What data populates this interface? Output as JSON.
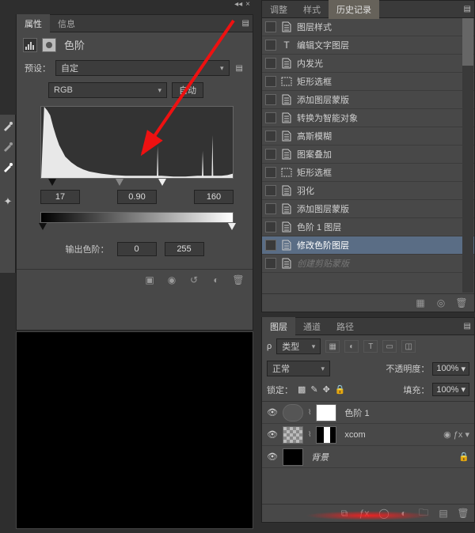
{
  "left": {
    "properties_tab": "属性",
    "info_tab": "信息",
    "panel_title": "色阶",
    "preset_label": "预设：",
    "preset_value": "自定",
    "channel_value": "RGB",
    "auto_btn": "自动",
    "input_levels": {
      "black": "17",
      "gamma": "0.90",
      "white": "160"
    },
    "output_label": "输出色阶：",
    "output_levels": {
      "black": "0",
      "white": "255"
    }
  },
  "right": {
    "adjust_tab": "调整",
    "styles_tab": "样式",
    "history_tab": "历史记录",
    "history": [
      {
        "icon": "doc",
        "label": "图层样式"
      },
      {
        "icon": "T",
        "label": "编辑文字图层"
      },
      {
        "icon": "doc",
        "label": "内发光"
      },
      {
        "icon": "rect",
        "label": "矩形选框"
      },
      {
        "icon": "doc",
        "label": "添加图层蒙版"
      },
      {
        "icon": "doc",
        "label": "转换为智能对象"
      },
      {
        "icon": "doc",
        "label": "高斯模糊"
      },
      {
        "icon": "doc",
        "label": "图案叠加"
      },
      {
        "icon": "rect",
        "label": "矩形选框"
      },
      {
        "icon": "doc",
        "label": "羽化"
      },
      {
        "icon": "doc",
        "label": "添加图层蒙版"
      },
      {
        "icon": "doc",
        "label": "色阶 1 图层"
      },
      {
        "icon": "doc",
        "label": "修改色阶图层",
        "selected": true
      },
      {
        "icon": "doc",
        "label": "创建剪贴蒙版",
        "dim": true
      }
    ]
  },
  "layers": {
    "tab_layers": "图层",
    "tab_channels": "通道",
    "tab_paths": "路径",
    "kind_label": "类型",
    "blend_mode": "正常",
    "opacity_label": "不透明度：",
    "opacity_value": "100%",
    "lock_label": "锁定：",
    "fill_label": "填充：",
    "fill_value": "100%",
    "items": [
      {
        "name": "色阶 1",
        "type": "adjust"
      },
      {
        "name": "xcom",
        "type": "smart",
        "fx": true
      },
      {
        "name": "背景",
        "type": "bg",
        "locked": true
      }
    ]
  },
  "chart_data": {
    "type": "area",
    "title": "",
    "xlabel": "",
    "ylabel": "",
    "xlim": [
      0,
      255
    ],
    "ylim": [
      0,
      100
    ],
    "series": [
      {
        "name": "luminance-histogram",
        "x": [
          0,
          4,
          8,
          12,
          16,
          20,
          24,
          28,
          32,
          40,
          48,
          56,
          64,
          80,
          96,
          112,
          128,
          144,
          155,
          160,
          176,
          192,
          208,
          215,
          224,
          228,
          240,
          248,
          255
        ],
        "values": [
          100,
          100,
          95,
          88,
          72,
          58,
          46,
          38,
          30,
          22,
          16,
          12,
          9,
          6,
          4,
          3,
          3,
          3,
          45,
          3,
          2,
          2,
          3,
          38,
          3,
          60,
          3,
          4,
          6
        ]
      }
    ],
    "input_markers": {
      "black": 17,
      "gamma": 0.9,
      "white": 160
    },
    "output_range": [
      0,
      255
    ]
  }
}
